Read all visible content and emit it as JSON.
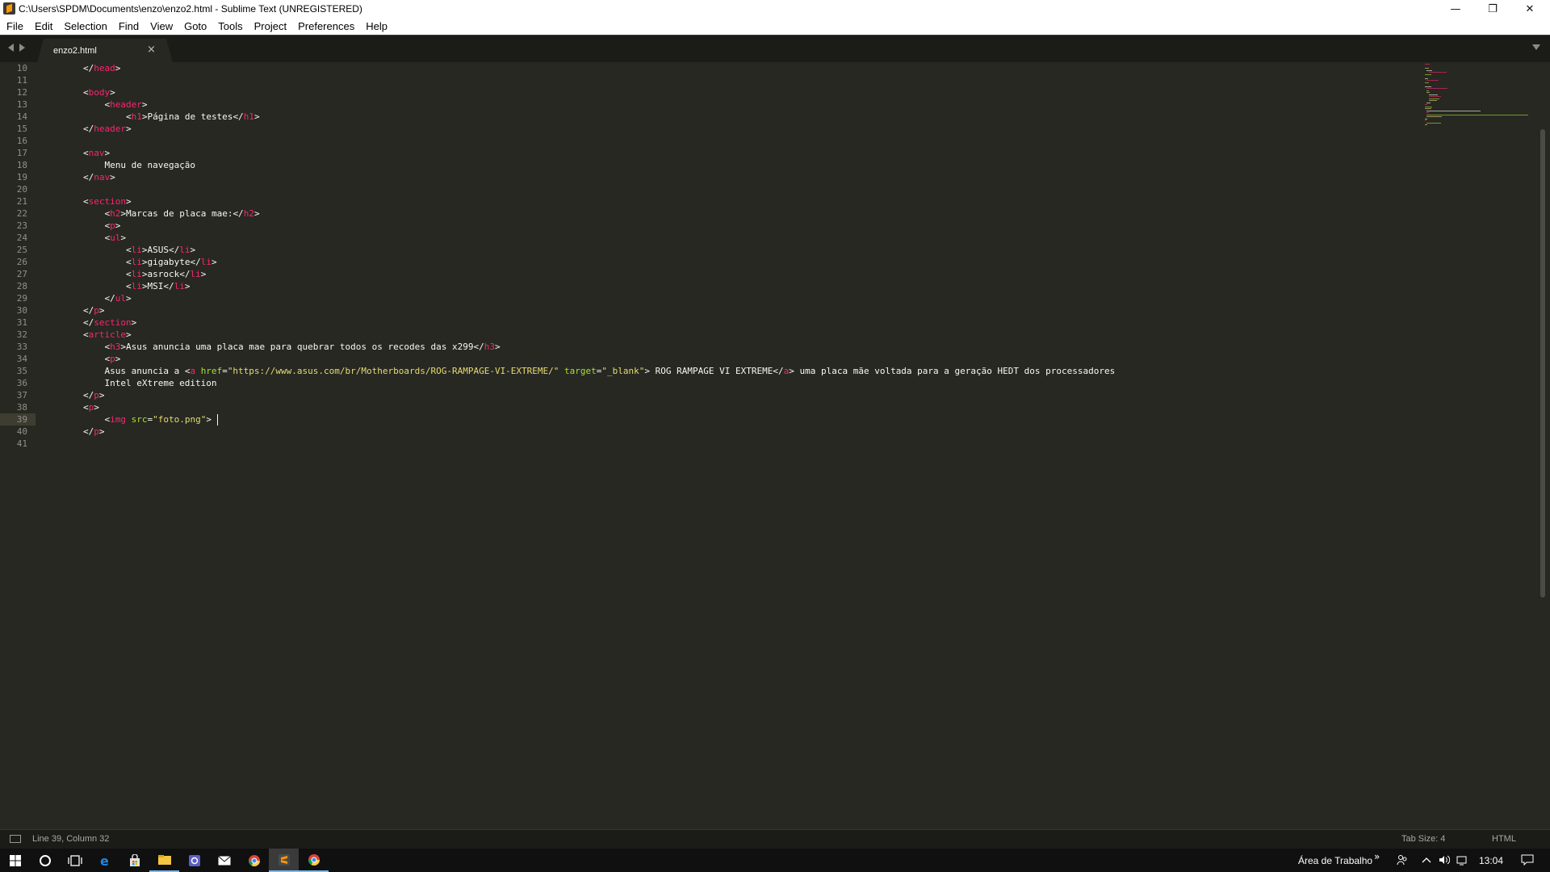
{
  "window": {
    "title": "C:\\Users\\SPDM\\Documents\\enzo\\enzo2.html - Sublime Text (UNREGISTERED)",
    "minimize_glyph": "—",
    "maximize_glyph": "❐",
    "close_glyph": "✕"
  },
  "menu": [
    "File",
    "Edit",
    "Selection",
    "Find",
    "View",
    "Goto",
    "Tools",
    "Project",
    "Preferences",
    "Help"
  ],
  "tab": {
    "label": "enzo2.html",
    "close_glyph": "×"
  },
  "editor": {
    "line_numbers": [
      "10",
      "11",
      "12",
      "13",
      "14",
      "15",
      "16",
      "17",
      "18",
      "19",
      "20",
      "21",
      "22",
      "23",
      "24",
      "25",
      "26",
      "27",
      "28",
      "29",
      "30",
      "31",
      "32",
      "33",
      "34",
      "35",
      "36",
      "37",
      "38",
      "39",
      "40",
      "41"
    ],
    "current_line": "39",
    "lines": [
      "        </head>",
      "",
      "        <body>",
      "            <header>",
      "                <h1>Página de testes</h1>",
      "        </header>",
      "",
      "        <nav>",
      "            Menu de navegação",
      "        </nav>",
      "",
      "        <section>",
      "            <h2>Marcas de placa mae:</h2>",
      "            <p>",
      "            <ul>",
      "                <li>ASUS</li>",
      "                <li>gigabyte</li>",
      "                <li>asrock</li>",
      "                <li>MSI</li>",
      "            </ul>",
      "        </p>",
      "        </section>",
      "        <article>",
      "            <h3>Asus anuncia uma placa mae para quebrar todos os recodes das x299</h3>",
      "            <p>",
      "            Asus anuncia a <a href=\"https://www.asus.com/br/Motherboards/ROG-RAMPAGE-VI-EXTREME/\" target=\"_blank\"> ROG RAMPAGE VI EXTREME</a> uma placa mãe voltada para a geração HEDT dos processadores",
      "            Intel eXtreme edition",
      "        </p>",
      "        <p>",
      "            <img src=\"foto.png\">",
      "        </p>",
      ""
    ]
  },
  "status": {
    "position": "Line 39, Column 32",
    "tab_size": "Tab Size: 4",
    "syntax": "HTML"
  },
  "taskbar": {
    "icons": [
      "windows-start-icon",
      "cortana-icon",
      "task-view-icon",
      "edge-icon",
      "store-icon",
      "file-explorer-icon",
      "settings-icon",
      "mail-icon",
      "chrome-icon",
      "sublime-text-icon",
      "chrome-icon"
    ],
    "desktop_label": "Área de Trabalho",
    "chevron": "»",
    "time": "13:04"
  },
  "colors": {
    "background": "#272822",
    "tag": "#f92672",
    "attribute": "#a6e22e",
    "string": "#e6db74",
    "text": "#f8f8f2",
    "line_number": "#8f908a"
  }
}
